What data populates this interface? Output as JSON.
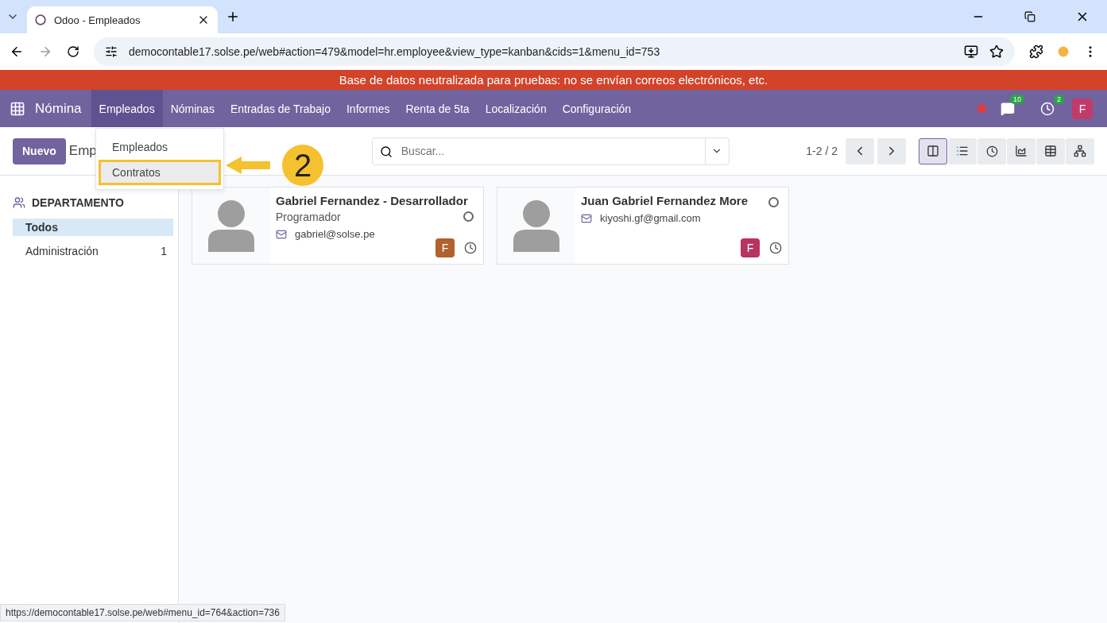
{
  "browser": {
    "tab_title": "Odoo - Empleados",
    "url": "democontable17.solse.pe/web#action=479&model=hr.employee&view_type=kanban&cids=1&menu_id=753",
    "status_url": "https://democontable17.solse.pe/web#menu_id=764&action=736"
  },
  "banner": "Base de datos neutralizada para pruebas: no se envían correos electrónicos, etc.",
  "navbar": {
    "app": "Nómina",
    "menus": [
      {
        "label": "Empleados",
        "selected": true
      },
      {
        "label": "Nóminas",
        "selected": false
      },
      {
        "label": "Entradas de Trabajo",
        "selected": false
      },
      {
        "label": "Informes",
        "selected": false
      },
      {
        "label": "Renta de 5ta",
        "selected": false
      },
      {
        "label": "Localización",
        "selected": false
      },
      {
        "label": "Configuración",
        "selected": false
      }
    ],
    "messages_count": "10",
    "activities_count": "2",
    "user_initial": "F"
  },
  "dropdown": {
    "items": [
      {
        "label": "Empleados",
        "selected": false
      },
      {
        "label": "Contratos",
        "selected": true
      }
    ]
  },
  "annotation": {
    "step": "2"
  },
  "control_panel": {
    "new_button": "Nuevo",
    "breadcrumb": "Emp",
    "search_placeholder": "Buscar...",
    "pager": "1-2 / 2",
    "views": [
      {
        "kind": "kanban",
        "selected": true
      },
      {
        "kind": "list",
        "selected": false
      },
      {
        "kind": "activity",
        "selected": false
      },
      {
        "kind": "graph",
        "selected": false
      },
      {
        "kind": "pivot",
        "selected": false
      },
      {
        "kind": "hierarchy",
        "selected": false
      }
    ]
  },
  "sidebar": {
    "title": "DEPARTAMENTO",
    "items": [
      {
        "label": "Todos",
        "selected": true
      },
      {
        "label": "Administración",
        "count": "1",
        "selected": false
      }
    ]
  },
  "employees": [
    {
      "name": "Gabriel Fernandez - Desarrollador",
      "job": "Programador",
      "email": "gabriel@solse.pe",
      "initial": "F",
      "color": "#b0612e"
    },
    {
      "name": "Juan Gabriel Fernandez More",
      "email": "kiyoshi.gf@gmail.com",
      "initial": "F",
      "color": "#b8335e"
    }
  ]
}
